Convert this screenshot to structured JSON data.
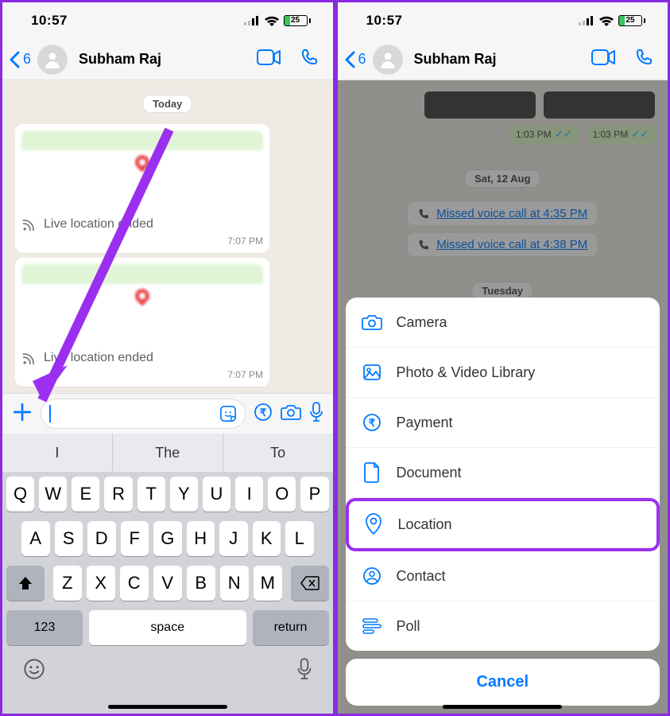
{
  "status": {
    "time": "10:57",
    "battery": "25"
  },
  "nav": {
    "back_count": "6",
    "contact_name": "Subham Raj"
  },
  "left": {
    "date_label": "Today",
    "bubbles": [
      {
        "text": "Live location ended",
        "time": "7:07 PM"
      },
      {
        "text": "Live location ended",
        "time": "7:07 PM"
      }
    ],
    "suggestions": [
      "I",
      "The",
      "To"
    ],
    "keyboard": {
      "row1": [
        "Q",
        "W",
        "E",
        "R",
        "T",
        "Y",
        "U",
        "I",
        "O",
        "P"
      ],
      "row2": [
        "A",
        "S",
        "D",
        "F",
        "G",
        "H",
        "J",
        "K",
        "L"
      ],
      "row3": [
        "Z",
        "X",
        "C",
        "V",
        "B",
        "N",
        "M"
      ],
      "k123": "123",
      "space": "space",
      "return": "return"
    }
  },
  "right": {
    "out_time": "1:03 PM",
    "date1": "Sat, 12 Aug",
    "missed1_prefix": "Missed voice call at ",
    "missed1_time": "4:35 PM",
    "missed2_prefix": "Missed voice call at ",
    "missed2_time": "4:38 PM",
    "date2": "Tuesday",
    "sheet": {
      "items": [
        {
          "label": "Camera",
          "icon": "camera-icon"
        },
        {
          "label": "Photo & Video Library",
          "icon": "image-icon"
        },
        {
          "label": "Payment",
          "icon": "rupee-icon"
        },
        {
          "label": "Document",
          "icon": "document-icon"
        },
        {
          "label": "Location",
          "icon": "location-pin-icon"
        },
        {
          "label": "Contact",
          "icon": "contact-icon"
        },
        {
          "label": "Poll",
          "icon": "poll-icon"
        }
      ],
      "cancel": "Cancel"
    }
  }
}
